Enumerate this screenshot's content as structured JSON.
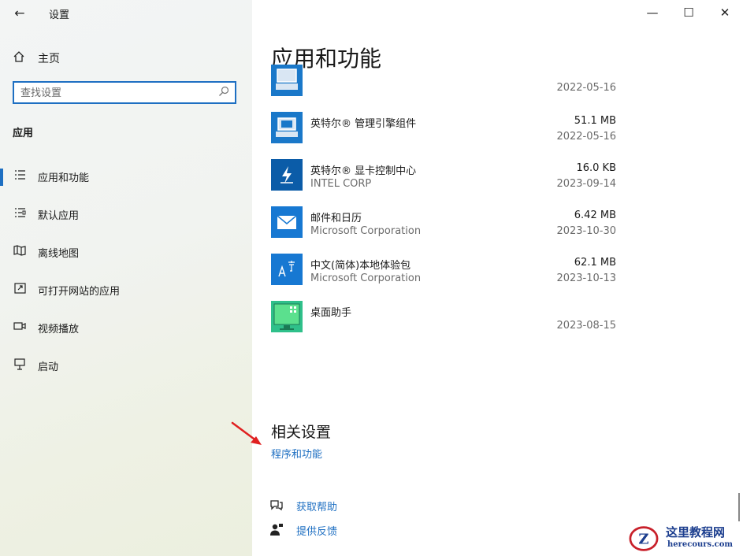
{
  "window": {
    "title": "设置",
    "back_glyph": "←",
    "minimize_glyph": "—",
    "maximize_glyph": "☐",
    "close_glyph": "✕"
  },
  "sidebar": {
    "home": {
      "label": "主页",
      "icon": "home-icon"
    },
    "search": {
      "placeholder": "查找设置",
      "value": "",
      "icon": "search-icon"
    },
    "section_label": "应用",
    "items": [
      {
        "label": "应用和功能",
        "icon": "list-icon",
        "selected": true
      },
      {
        "label": "默认应用",
        "icon": "default-apps-icon",
        "selected": false
      },
      {
        "label": "离线地图",
        "icon": "map-icon",
        "selected": false
      },
      {
        "label": "可打开网站的应用",
        "icon": "open-in-window-icon",
        "selected": false
      },
      {
        "label": "视频播放",
        "icon": "video-icon",
        "selected": false
      },
      {
        "label": "启动",
        "icon": "startup-icon",
        "selected": false
      }
    ],
    "accent_color": "#1e6fc2"
  },
  "main": {
    "heading": "应用和功能",
    "apps": [
      {
        "name": "",
        "publisher": "",
        "size": "",
        "date": "2022-05-16",
        "tile_color": "#1a78c9",
        "icon": "intel-driver-icon"
      },
      {
        "name": "英特尔® 管理引擎组件",
        "publisher": "",
        "size": "51.1 MB",
        "date": "2022-05-16",
        "tile_color": "#1a78c9",
        "icon": "intel-driver-icon"
      },
      {
        "name": "英特尔® 显卡控制中心",
        "publisher": "INTEL CORP",
        "size": "16.0 KB",
        "date": "2023-09-14",
        "tile_color": "#0b5ca8",
        "icon": "intel-graphics-icon"
      },
      {
        "name": "邮件和日历",
        "publisher": "Microsoft Corporation",
        "size": "6.42 MB",
        "date": "2023-10-30",
        "tile_color": "#1778d2",
        "icon": "mail-icon"
      },
      {
        "name": "中文(简体)本地体验包",
        "publisher": "Microsoft Corporation",
        "size": "62.1 MB",
        "date": "2023-10-13",
        "tile_color": "#1778d2",
        "icon": "language-pack-icon"
      },
      {
        "name": "桌面助手",
        "publisher": "",
        "size": "",
        "date": "2023-08-15",
        "tile_color": "#1ea37f",
        "icon": "desktop-assistant-icon"
      }
    ],
    "related_heading": "相关设置",
    "related_link": "程序和功能",
    "help_links": [
      {
        "label": "获取帮助",
        "icon": "help-chat-icon"
      },
      {
        "label": "提供反馈",
        "icon": "feedback-icon"
      }
    ],
    "link_color": "#1e6fc2"
  },
  "watermark": {
    "text_cn": "这里教程网",
    "text_url": "herecours.com",
    "logo_letter": "Z",
    "colors": {
      "ring": "#c8202a",
      "text": "#1d3f8f"
    }
  },
  "annotation": {
    "arrow_color": "#e02020"
  }
}
